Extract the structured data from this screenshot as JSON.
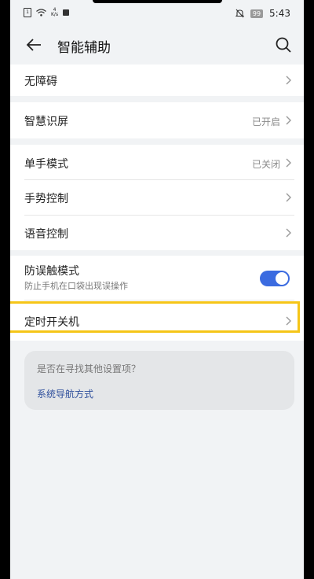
{
  "status_bar": {
    "sim_label": "1",
    "speed_top": "4",
    "speed_bottom": "K/s",
    "battery": "99",
    "time": "5:43"
  },
  "header": {
    "title": "智能辅助"
  },
  "rows": {
    "accessibility": {
      "label": "无障碍"
    },
    "smart_screen": {
      "label": "智慧识屏",
      "value": "已开启"
    },
    "one_hand": {
      "label": "单手模式",
      "value": "已关闭"
    },
    "gesture": {
      "label": "手势控制"
    },
    "voice": {
      "label": "语音控制"
    },
    "pocket_mode": {
      "label": "防误触模式",
      "description": "防止手机在口袋出现误操作"
    },
    "scheduled_power": {
      "label": "定时开关机"
    }
  },
  "suggestion": {
    "question": "是否在寻找其他设置项？",
    "link": "系统导航方式"
  },
  "colors": {
    "accent": "#3b6be0",
    "highlight": "#f5c518",
    "link": "#2e4f9c"
  }
}
